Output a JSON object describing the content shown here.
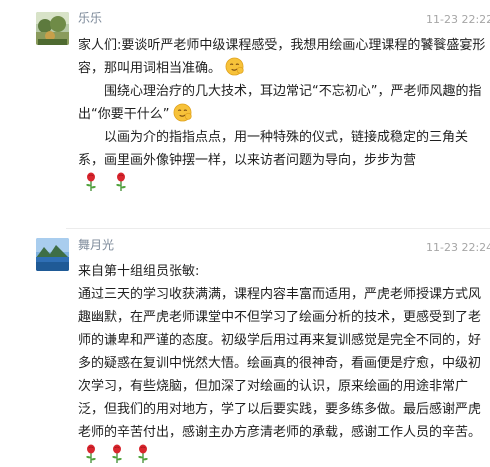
{
  "messages": [
    {
      "sender": "乐乐",
      "time": "11-23 22:22",
      "avatar_icon": "landscape-photo-avatar",
      "paragraphs": {
        "p1": "家人们:要谈听严老师中级课程感受，我想用绘画心理课程的饕餮盛宴形容，那叫用词相当准确。",
        "p2": "围绕心理治疗的几大技术，耳边常记“不忘初心”，严老师风趣的指出“你要干什么”",
        "p3": "以画为介的指指点点，用一种特殊的仪式，链接成稳定的三角关系，画里画外像钟摆一样，以来访者问题为导向，步步为营"
      },
      "emoji_icons": [
        "smirk-face-emoji",
        "smirk-face-emoji",
        "rose-emoji",
        "rose-emoji"
      ]
    },
    {
      "sender": "舞月光",
      "time": "11-23 22:24",
      "avatar_icon": "mountain-lake-avatar",
      "paragraphs": {
        "p1": "来自第十组组员张敏:",
        "p2": "通过三天的学习收获满满，课程内容丰富而适用，严虎老师授课方式风趣幽默，在严虎老师课堂中不但学习了绘画分析的技术，更感受到了老师的谦卑和严谨的态度。初级学后用过再来复训感觉是完全不同的，好多的疑惑在复训中恍然大悟。绘画真的很神奇，看画便是疗愈，中级初次学习，有些烧脑，但加深了对绘画的认识，原来绘画的用途非常广泛，但我们的用对地方，学了以后要实践，要多练多做。最后感谢严虎老师的辛苦付出，感谢主办方彦清老师的承载，感谢工作人员的辛苦。"
      },
      "emoji_icons": [
        "rose-emoji",
        "rose-emoji",
        "rose-emoji"
      ]
    }
  ]
}
